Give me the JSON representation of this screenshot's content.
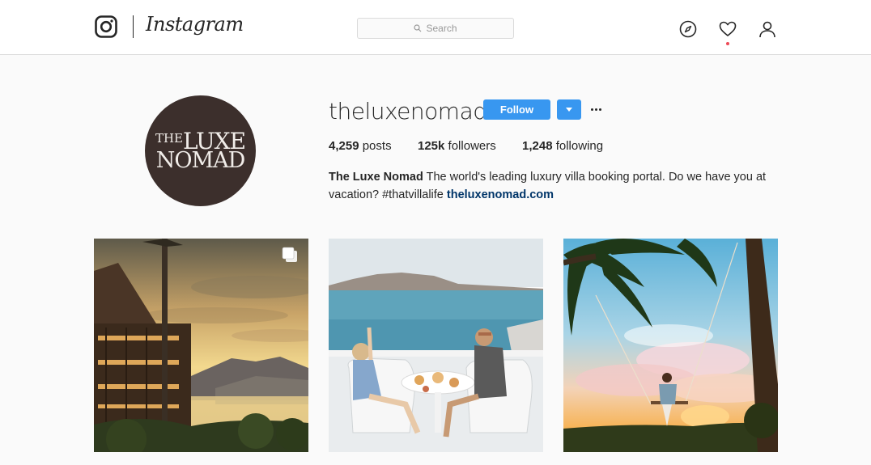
{
  "nav": {
    "brand": "Instagram",
    "search_placeholder": "Search",
    "icons": [
      "instagram-glyph-icon",
      "search-icon",
      "explore-compass-icon",
      "activity-heart-icon",
      "profile-person-icon"
    ],
    "has_notification": true
  },
  "profile": {
    "avatar_logo": {
      "line1_small": "THE",
      "line1": "LUXE",
      "line2": "NOMAD"
    },
    "username": "theluxenomad",
    "follow_label": "Follow",
    "stats": {
      "posts_count": "4,259",
      "posts_label": "posts",
      "followers_count": "125k",
      "followers_label": "followers",
      "following_count": "1,248",
      "following_label": "following"
    },
    "bio": {
      "name": "The Luxe Nomad",
      "text": " The world's leading luxury villa booking portal. Do we have you at vacation? #thatvillalife ",
      "link": "theluxenomad.com"
    }
  },
  "grid": {
    "posts": [
      {
        "subject": "sunset-villa-over-lake",
        "multiple": true
      },
      {
        "subject": "couple-breakfast-santorini",
        "multiple": false
      },
      {
        "subject": "palm-tree-swing-sunset",
        "multiple": false
      }
    ]
  },
  "colors": {
    "accent": "#3897f0",
    "link": "#003569",
    "notification": "#ed4956",
    "avatar_bg": "#3c2f2c"
  }
}
